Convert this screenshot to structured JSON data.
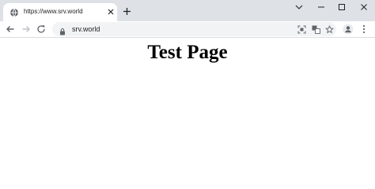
{
  "tab": {
    "title": "https://www.srv.world"
  },
  "toolbar": {
    "url": "srv.world"
  },
  "page": {
    "heading": "Test Page"
  },
  "icons": {
    "favicon": "globe-icon",
    "tab_close": "close-icon",
    "new_tab": "plus-icon",
    "tab_search": "chevron-down-icon",
    "minimize": "minimize-icon",
    "maximize": "maximize-icon",
    "close_window": "close-icon",
    "back": "arrow-left-icon",
    "forward": "arrow-right-icon",
    "reload": "reload-icon",
    "lock": "lock-icon",
    "screenshot": "screen-capture-icon",
    "translate": "translate-icon",
    "bookmark": "star-icon",
    "profile": "profile-icon",
    "menu": "kebab-menu-icon"
  },
  "colors": {
    "tabstrip_bg": "#dee1e6",
    "omnibox_bg": "#f1f3f4",
    "icon": "#5f6368",
    "text": "#202124",
    "disabled_icon": "#bdc1c6"
  }
}
